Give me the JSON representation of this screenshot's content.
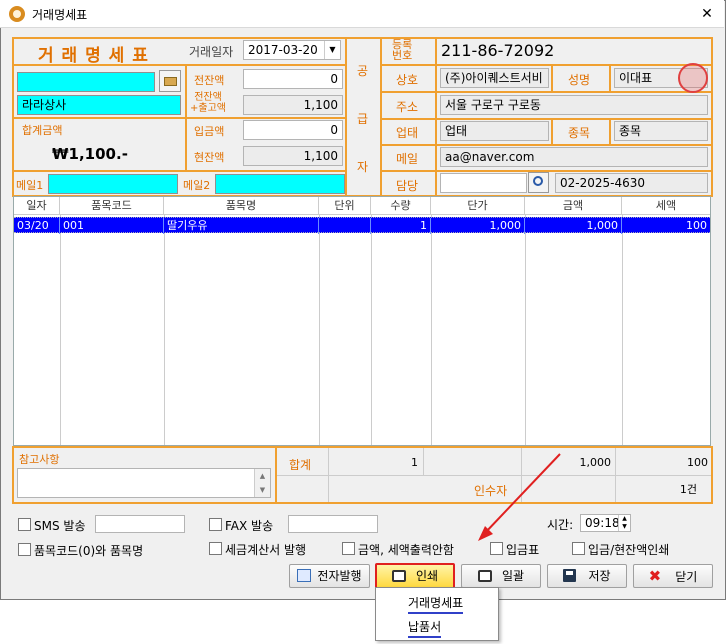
{
  "window": {
    "title": "거래명세표"
  },
  "header": {
    "form_title": "거 래 명 세 표",
    "date_label": "거래일자",
    "date_value": "2017-03-20"
  },
  "customer": {
    "code_value": "",
    "name_value": "라라상사"
  },
  "balance": {
    "prev_label": "전잔액",
    "prev_value": "0",
    "prev_plus_label_1": "전잔액",
    "prev_plus_label_2": "+출고액",
    "prev_plus_value": "1,100",
    "paid_label": "입금액",
    "paid_value": "0",
    "current_label": "현잔액",
    "current_value": "1,100",
    "total_label": "합계금액",
    "total_value": "₩1,100.-"
  },
  "mail": {
    "mail1_label": "메일1",
    "mail1_value": "",
    "mail2_label": "메일2",
    "mail2_value": ""
  },
  "supplier": {
    "side_chars": [
      "공",
      "급",
      "자"
    ],
    "reg_label_1": "등록",
    "reg_label_2": "번호",
    "reg_value": "211-86-72092",
    "company_label": "상호",
    "company_value": "(주)아이퀘스트서비",
    "ceo_label": "성명",
    "ceo_value": "이대표",
    "address_label": "주소",
    "address_value": "서울 구로구 구로동",
    "biz_type_label": "업태",
    "biz_type_value": "업태",
    "biz_item_label": "종목",
    "biz_item_value": "종목",
    "email_label": "메일",
    "email_value": "aa@naver.com",
    "manager_label": "담당",
    "manager_value": "",
    "phone_value": "02-2025-4630"
  },
  "grid": {
    "columns": [
      "일자",
      "품목코드",
      "품목명",
      "단위",
      "수량",
      "단가",
      "금액",
      "세액"
    ],
    "rows": [
      {
        "date": "03/20",
        "code": "001",
        "name": "딸기우유",
        "unit": "",
        "qty": "1",
        "price": "1,000",
        "amount": "1,000",
        "tax": "100"
      }
    ]
  },
  "footer": {
    "memo_label": "참고사항",
    "memo_value": "",
    "sum_label": "합계",
    "sum_qty": "1",
    "sum_amount": "1,000",
    "sum_tax": "100",
    "receiver_label": "인수자",
    "count_value": "1건"
  },
  "options": {
    "sms_label": "SMS 발송",
    "sms_value": "",
    "fax_label": "FAX 발송",
    "fax_value": "",
    "time_label": "시간:",
    "time_value": "09:18",
    "code_name_label": "품목코드(0)와 품목명",
    "tax_invoice_label": "세금계산서 발행",
    "no_amount_label": "금액, 세액출력안함",
    "deposit_label": "입금표",
    "deposit_balance_label": "입금/현잔액인쇄"
  },
  "buttons": {
    "edoc": "전자발행",
    "print": "인쇄",
    "batch": "일괄",
    "save": "저장",
    "close": "닫기"
  },
  "print_menu": {
    "items": [
      "거래명세표",
      "납품서"
    ]
  },
  "colors": {
    "accent": "#f0a030",
    "selection": "#0000ff",
    "highlight_red": "#e02020",
    "cyan_field": "#00ffff"
  }
}
